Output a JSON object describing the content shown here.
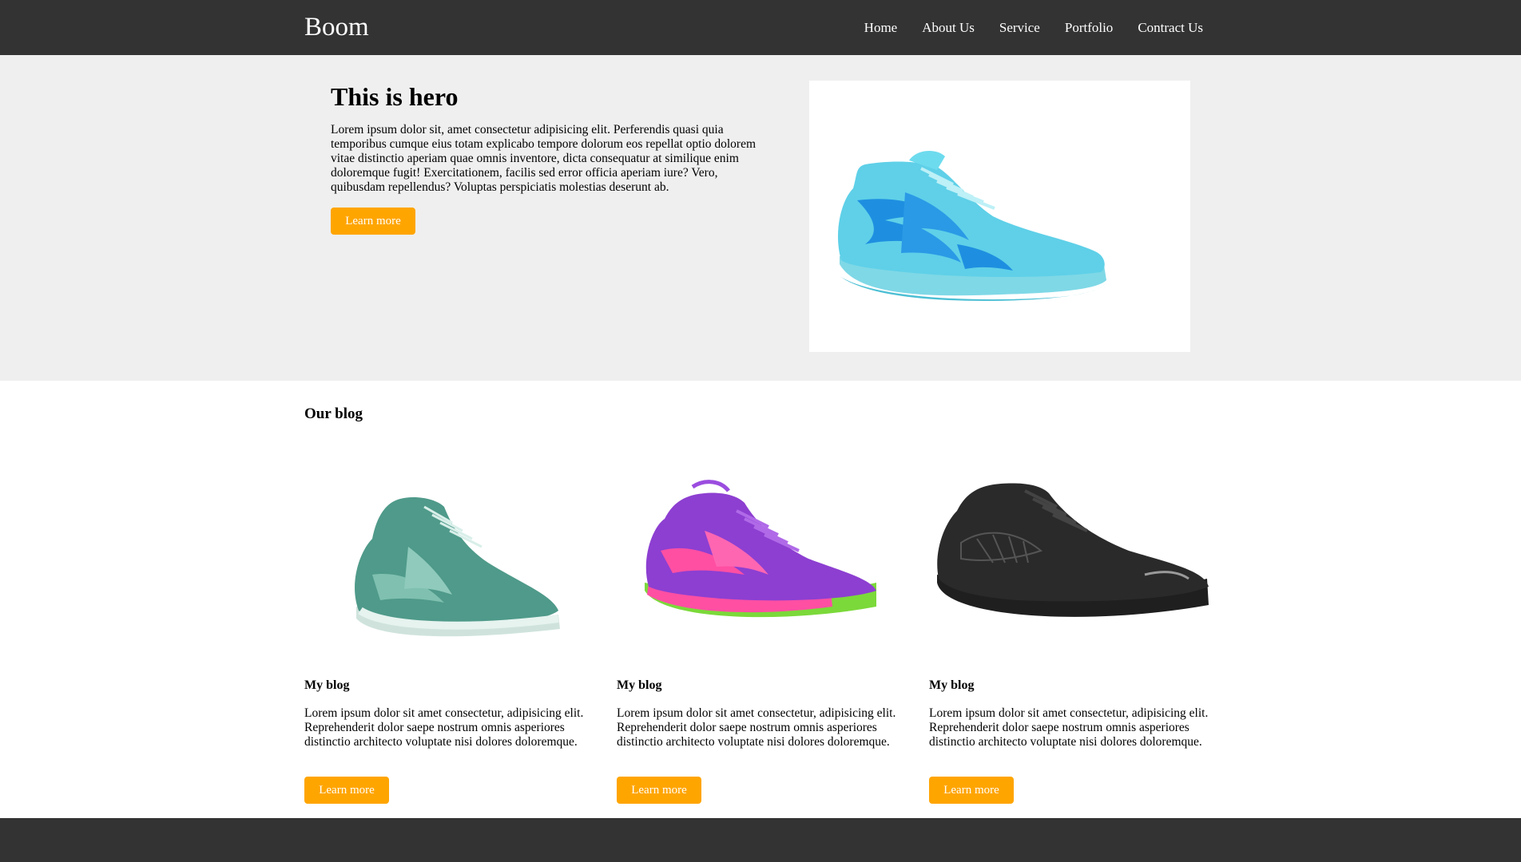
{
  "nav": {
    "brand": "Boom",
    "links": [
      "Home",
      "About Us",
      "Service",
      "Portfolio",
      "Contract Us"
    ]
  },
  "hero": {
    "title": "This is hero",
    "text": "Lorem ipsum dolor sit, amet consectetur adipisicing elit. Perferendis quasi quia temporibus cumque eius totam explicabo tempore dolorum eos repellat optio dolorem vitae distinctio aperiam quae omnis inventore, dicta consequatur at similique enim doloremque fugit! Exercitationem, facilis sed error officia aperiam iure? Vero, quibusdam repellendus? Voluptas perspiciatis molestias deserunt ab.",
    "button": "Learn more",
    "image_icon": "turquoise-basketball-shoe"
  },
  "blog": {
    "title": "Our blog",
    "cards": [
      {
        "title": "My blog",
        "text": "Lorem ipsum dolor sit amet consectetur, adipisicing elit. Reprehenderit dolor saepe nostrum omnis asperiores distinctio architecto voluptate nisi dolores doloremque.",
        "button": "Learn more",
        "image_icon": "green-basketball-shoe"
      },
      {
        "title": "My blog",
        "text": "Lorem ipsum dolor sit amet consectetur, adipisicing elit. Reprehenderit dolor saepe nostrum omnis asperiores distinctio architecto voluptate nisi dolores doloremque.",
        "button": "Learn more",
        "image_icon": "purple-pink-basketball-shoe"
      },
      {
        "title": "My blog",
        "text": "Lorem ipsum dolor sit amet consectetur, adipisicing elit. Reprehenderit dolor saepe nostrum omnis asperiores distinctio architecto voluptate nisi dolores doloremque.",
        "button": "Learn more",
        "image_icon": "black-basketball-shoe"
      }
    ]
  },
  "colors": {
    "navbar": "#333333",
    "hero_bg": "#efefef",
    "accent": "#ffa500"
  }
}
